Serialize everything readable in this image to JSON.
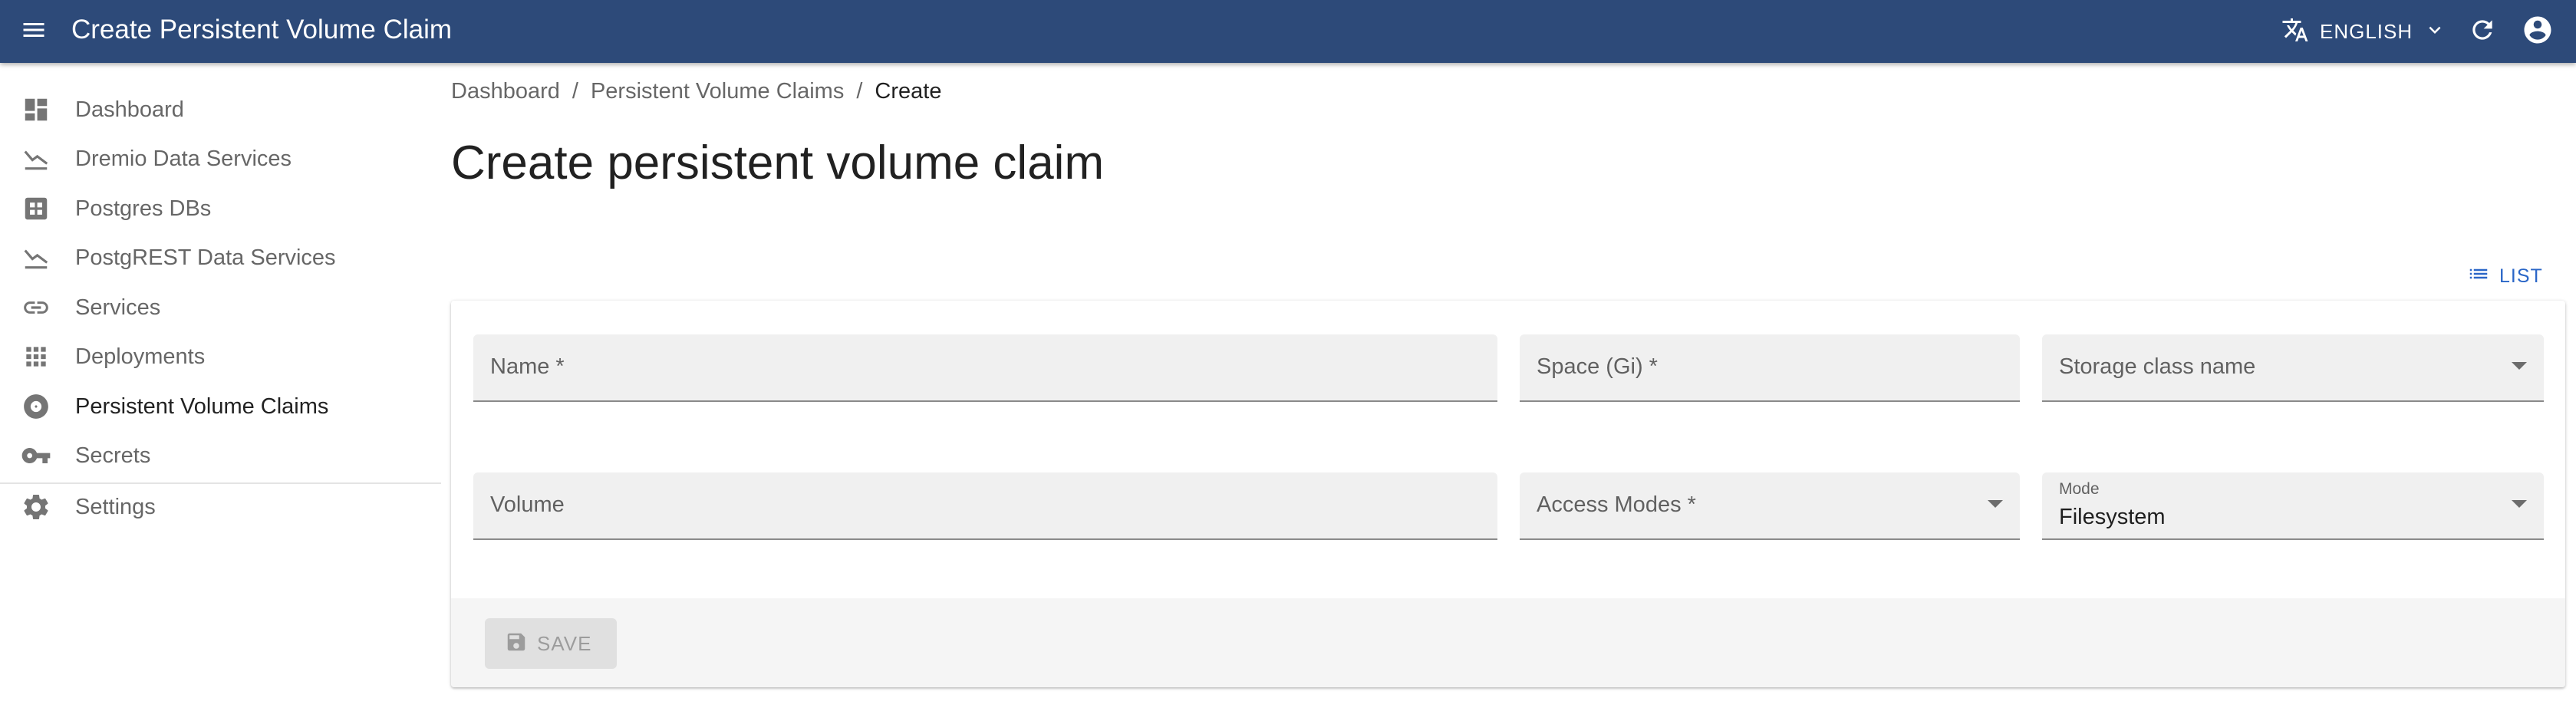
{
  "app": {
    "title": "Create Persistent Volume Claim",
    "language_label": "ENGLISH",
    "header_color": "#2d4a79",
    "icons": [
      "menu-icon",
      "translate-icon",
      "chevron-down-icon",
      "refresh-icon",
      "account-circle-icon"
    ]
  },
  "sidebar": {
    "items": [
      {
        "label": "Dashboard",
        "icon": "dashboard-icon"
      },
      {
        "label": "Dremio Data Services",
        "icon": "stats-arrow-icon"
      },
      {
        "label": "Postgres DBs",
        "icon": "grid-box-icon"
      },
      {
        "label": "PostgREST Data Services",
        "icon": "stats-arrow-icon"
      },
      {
        "label": "Services",
        "icon": "link-icon"
      },
      {
        "label": "Deployments",
        "icon": "apps-icon"
      },
      {
        "label": "Persistent Volume Claims",
        "icon": "disc-icon",
        "active": true
      },
      {
        "label": "Secrets",
        "icon": "key-icon"
      },
      {
        "label": "Settings",
        "icon": "gear-icon"
      }
    ]
  },
  "breadcrumb": {
    "items": [
      "Dashboard",
      "Persistent Volume Claims",
      "Create"
    ],
    "separator": "/"
  },
  "page": {
    "title": "Create persistent volume claim",
    "list_label": "LIST",
    "accent_color": "#2a66c7"
  },
  "form": {
    "name_label": "Name *",
    "space_label": "Space (Gi) *",
    "storage_class_label": "Storage class name",
    "volume_label": "Volume",
    "access_modes_label": "Access Modes *",
    "mode_label": "Mode",
    "mode_value": "Filesystem",
    "save_label": "SAVE"
  }
}
